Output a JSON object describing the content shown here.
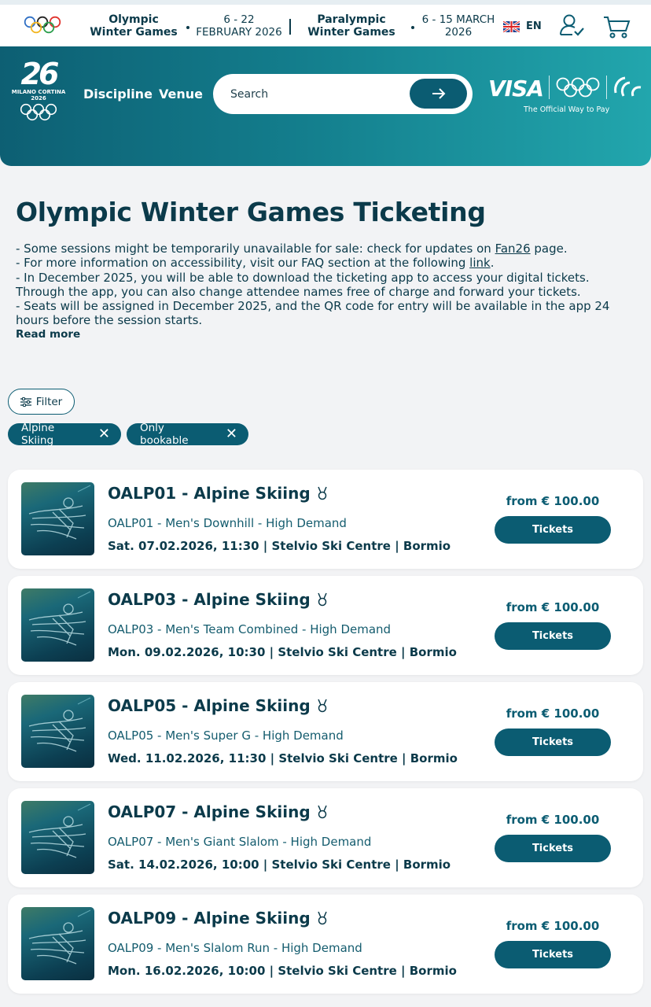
{
  "topbar": {
    "olympic_title": "Olympic Winter Games",
    "olympic_dates": "6 - 22 FEBRUARY 2026",
    "paralympic_title": "Paralympic Winter Games",
    "paralympic_dates": "6 - 15 MARCH 2026",
    "language": "EN",
    "icons": [
      "olympic-rings-icon",
      "uk-flag-icon",
      "account-icon",
      "cart-icon"
    ]
  },
  "header": {
    "logo_mark": "26",
    "logo_text_1": "MILANO CORTINA",
    "logo_text_2": "2026",
    "nav": [
      "Discipline",
      "Venue"
    ],
    "search_placeholder": "Search",
    "sponsor": "VISA",
    "sponsor_tagline": "The Official Way to Pay",
    "colors": {
      "gradient_start": "#0d5f73",
      "gradient_end": "#22a6ad"
    }
  },
  "intro": {
    "title": "Olympic Winter Games Ticketing",
    "line1_before": "- Some sessions might be temporarily unavailable for sale: check for updates on ",
    "line1_link": "Fan26",
    "line1_after": " page.",
    "line2_before": "- For more information on accessibility, visit our FAQ section at the following ",
    "line2_link": "link",
    "line2_after": ".",
    "line3": "- In December 2025, you will be able to download the ticketing app to access your digital tickets. Through the app, you can also change attendee names free of charge and forward your tickets.",
    "line4": "- Seats will be assigned in December 2025, and the QR code for entry will be available in the app 24 hours before the session starts.",
    "read_more": "Read more"
  },
  "filters": {
    "filter_label": "Filter",
    "chips": [
      "Alpine Skiing",
      "Only bookable"
    ]
  },
  "sessions": [
    {
      "title": "OALP01 - Alpine Skiing",
      "subtitle": "OALP01 - Men's Downhill - High Demand",
      "meta": "Sat. 07.02.2026, 11:30  |  Stelvio Ski Centre  |  Bormio",
      "price": "from € 100.00",
      "button": "Tickets"
    },
    {
      "title": "OALP03 - Alpine Skiing",
      "subtitle": "OALP03 - Men's Team Combined - High Demand",
      "meta": "Mon. 09.02.2026, 10:30  |  Stelvio Ski Centre  |  Bormio",
      "price": "from € 100.00",
      "button": "Tickets"
    },
    {
      "title": "OALP05 - Alpine Skiing",
      "subtitle": "OALP05 - Men's Super G - High Demand",
      "meta": "Wed. 11.02.2026, 11:30  |  Stelvio Ski Centre  |  Bormio",
      "price": "from € 100.00",
      "button": "Tickets"
    },
    {
      "title": "OALP07 - Alpine Skiing",
      "subtitle": "OALP07 - Men's Giant Slalom - High Demand",
      "meta": "Sat. 14.02.2026, 10:00  |  Stelvio Ski Centre  |  Bormio",
      "price": "from € 100.00",
      "button": "Tickets"
    },
    {
      "title": "OALP09 - Alpine Skiing",
      "subtitle": "OALP09 - Men's Slalom Run - High Demand",
      "meta": "Mon. 16.02.2026, 10:00  |  Stelvio Ski Centre  |  Bormio",
      "price": "from € 100.00",
      "button": "Tickets"
    }
  ]
}
